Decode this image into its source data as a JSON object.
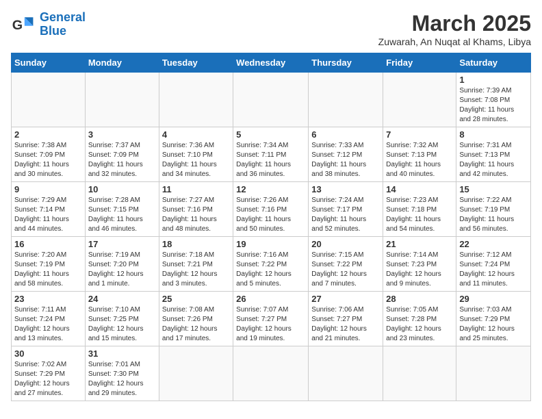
{
  "logo": {
    "line1": "General",
    "line2": "Blue"
  },
  "title": "March 2025",
  "location": "Zuwarah, An Nuqat al Khams, Libya",
  "weekdays": [
    "Sunday",
    "Monday",
    "Tuesday",
    "Wednesday",
    "Thursday",
    "Friday",
    "Saturday"
  ],
  "days": {
    "1": {
      "sunrise": "7:39 AM",
      "sunset": "7:08 PM",
      "daylight": "11 hours and 28 minutes."
    },
    "2": {
      "sunrise": "7:38 AM",
      "sunset": "7:09 PM",
      "daylight": "11 hours and 30 minutes."
    },
    "3": {
      "sunrise": "7:37 AM",
      "sunset": "7:09 PM",
      "daylight": "11 hours and 32 minutes."
    },
    "4": {
      "sunrise": "7:36 AM",
      "sunset": "7:10 PM",
      "daylight": "11 hours and 34 minutes."
    },
    "5": {
      "sunrise": "7:34 AM",
      "sunset": "7:11 PM",
      "daylight": "11 hours and 36 minutes."
    },
    "6": {
      "sunrise": "7:33 AM",
      "sunset": "7:12 PM",
      "daylight": "11 hours and 38 minutes."
    },
    "7": {
      "sunrise": "7:32 AM",
      "sunset": "7:13 PM",
      "daylight": "11 hours and 40 minutes."
    },
    "8": {
      "sunrise": "7:31 AM",
      "sunset": "7:13 PM",
      "daylight": "11 hours and 42 minutes."
    },
    "9": {
      "sunrise": "7:29 AM",
      "sunset": "7:14 PM",
      "daylight": "11 hours and 44 minutes."
    },
    "10": {
      "sunrise": "7:28 AM",
      "sunset": "7:15 PM",
      "daylight": "11 hours and 46 minutes."
    },
    "11": {
      "sunrise": "7:27 AM",
      "sunset": "7:16 PM",
      "daylight": "11 hours and 48 minutes."
    },
    "12": {
      "sunrise": "7:26 AM",
      "sunset": "7:16 PM",
      "daylight": "11 hours and 50 minutes."
    },
    "13": {
      "sunrise": "7:24 AM",
      "sunset": "7:17 PM",
      "daylight": "11 hours and 52 minutes."
    },
    "14": {
      "sunrise": "7:23 AM",
      "sunset": "7:18 PM",
      "daylight": "11 hours and 54 minutes."
    },
    "15": {
      "sunrise": "7:22 AM",
      "sunset": "7:19 PM",
      "daylight": "11 hours and 56 minutes."
    },
    "16": {
      "sunrise": "7:20 AM",
      "sunset": "7:19 PM",
      "daylight": "11 hours and 58 minutes."
    },
    "17": {
      "sunrise": "7:19 AM",
      "sunset": "7:20 PM",
      "daylight": "12 hours and 1 minute."
    },
    "18": {
      "sunrise": "7:18 AM",
      "sunset": "7:21 PM",
      "daylight": "12 hours and 3 minutes."
    },
    "19": {
      "sunrise": "7:16 AM",
      "sunset": "7:22 PM",
      "daylight": "12 hours and 5 minutes."
    },
    "20": {
      "sunrise": "7:15 AM",
      "sunset": "7:22 PM",
      "daylight": "12 hours and 7 minutes."
    },
    "21": {
      "sunrise": "7:14 AM",
      "sunset": "7:23 PM",
      "daylight": "12 hours and 9 minutes."
    },
    "22": {
      "sunrise": "7:12 AM",
      "sunset": "7:24 PM",
      "daylight": "12 hours and 11 minutes."
    },
    "23": {
      "sunrise": "7:11 AM",
      "sunset": "7:24 PM",
      "daylight": "12 hours and 13 minutes."
    },
    "24": {
      "sunrise": "7:10 AM",
      "sunset": "7:25 PM",
      "daylight": "12 hours and 15 minutes."
    },
    "25": {
      "sunrise": "7:08 AM",
      "sunset": "7:26 PM",
      "daylight": "12 hours and 17 minutes."
    },
    "26": {
      "sunrise": "7:07 AM",
      "sunset": "7:27 PM",
      "daylight": "12 hours and 19 minutes."
    },
    "27": {
      "sunrise": "7:06 AM",
      "sunset": "7:27 PM",
      "daylight": "12 hours and 21 minutes."
    },
    "28": {
      "sunrise": "7:05 AM",
      "sunset": "7:28 PM",
      "daylight": "12 hours and 23 minutes."
    },
    "29": {
      "sunrise": "7:03 AM",
      "sunset": "7:29 PM",
      "daylight": "12 hours and 25 minutes."
    },
    "30": {
      "sunrise": "7:02 AM",
      "sunset": "7:29 PM",
      "daylight": "12 hours and 27 minutes."
    },
    "31": {
      "sunrise": "7:01 AM",
      "sunset": "7:30 PM",
      "daylight": "12 hours and 29 minutes."
    }
  }
}
